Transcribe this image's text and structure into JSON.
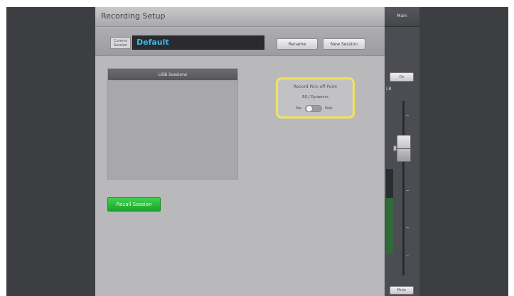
{
  "panel": {
    "title": "Recording Setup",
    "current_session_label": "Current Session",
    "session_name": "Default",
    "rename_label": "Rename",
    "new_session_label": "New Session",
    "usb_sessions_header": "USB Sessions",
    "usb_sessions": [],
    "recall_label": "Recall Session",
    "pickoff": {
      "title": "Record Pick-off Point",
      "subtitle": "EQ / Dynamics",
      "pre_label": "Pre",
      "post_label": "Post",
      "selected": "Pre"
    }
  },
  "master": {
    "label": "Main",
    "lr_button": "On",
    "lr_text": "LR",
    "mute_label": "Mute",
    "meter_level": 0.66,
    "fader_level": 0.74
  },
  "colors": {
    "session_name_text": "#39b8e8",
    "recall_button": "#1ca32c",
    "highlight": "#f1e45a"
  }
}
